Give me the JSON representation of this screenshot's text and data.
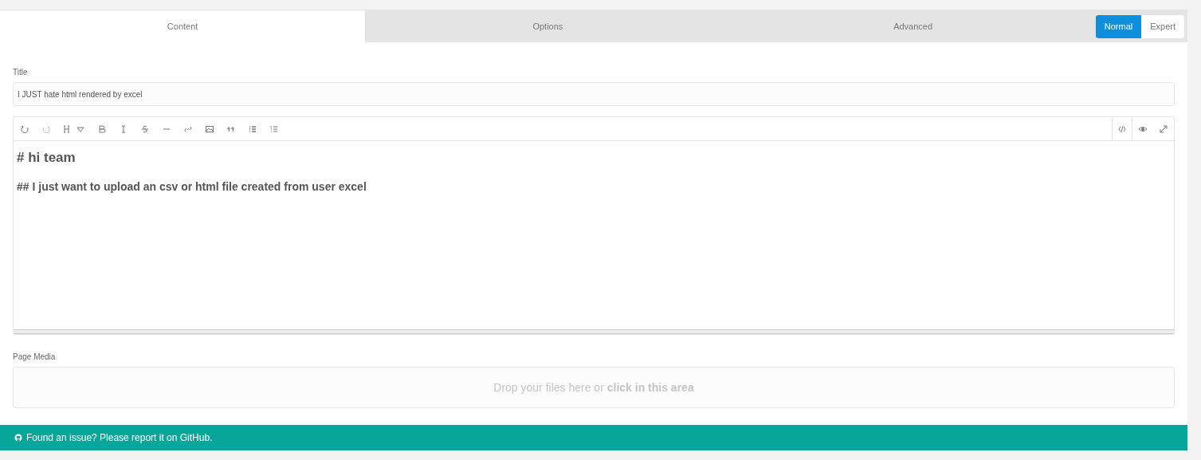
{
  "tabs": [
    {
      "label": "Content",
      "selected": true
    },
    {
      "label": "Options",
      "selected": false
    },
    {
      "label": "Advanced",
      "selected": false
    }
  ],
  "mode_switch": [
    {
      "label": "Normal",
      "selected": true
    },
    {
      "label": "Expert",
      "selected": false
    }
  ],
  "title_field": {
    "label": "Title",
    "value": "I JUST hate html rendered by excel"
  },
  "editor": {
    "toolbar": [
      {
        "kind": "undo"
      },
      {
        "kind": "redo"
      },
      {
        "kind": "heading"
      },
      {
        "kind": "bold"
      },
      {
        "kind": "italic"
      },
      {
        "kind": "strike"
      },
      {
        "kind": "rule"
      },
      {
        "kind": "link"
      },
      {
        "kind": "image"
      },
      {
        "kind": "quote"
      },
      {
        "kind": "bullets"
      },
      {
        "kind": "numbers"
      }
    ],
    "view_buttons": [
      {
        "kind": "code",
        "selected": true
      },
      {
        "kind": "preview",
        "selected": false
      },
      {
        "kind": "fullscreen",
        "selected": false
      }
    ],
    "lines": [
      {
        "kind": "h1",
        "text": "# hi team"
      },
      {
        "kind": "h2",
        "text": "## I just want to upload an csv or html file created from user excel"
      }
    ]
  },
  "page_media": {
    "label": "Page Media",
    "dropzone": "Drop your files here or **click in this area**"
  },
  "footer": {
    "text": "Found an issue? Please report it on GitHub."
  }
}
